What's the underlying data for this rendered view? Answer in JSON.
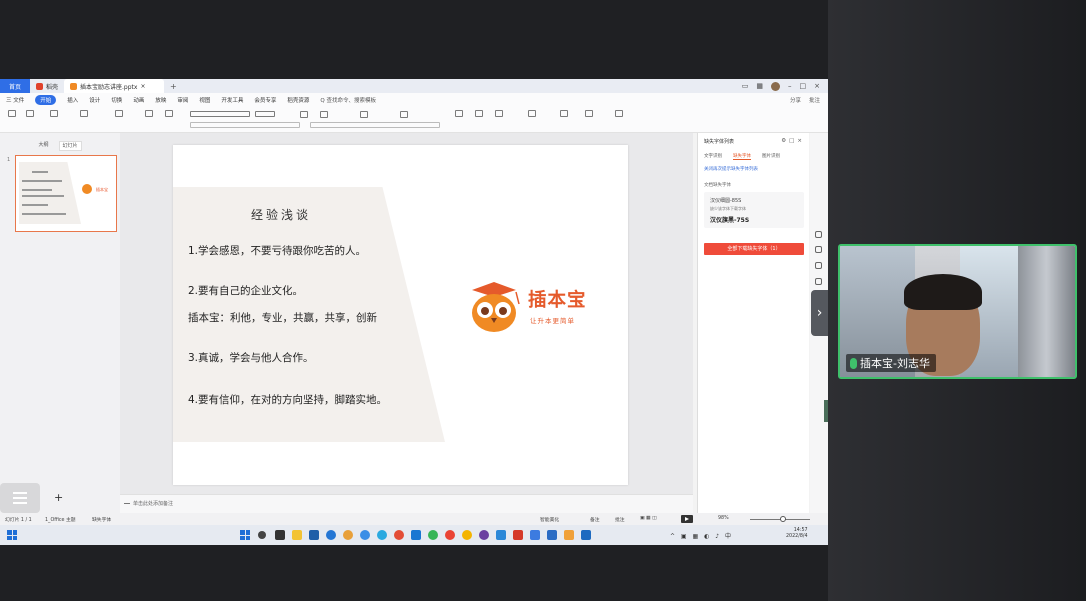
{
  "wps": {
    "tabs": [
      {
        "label": "首页"
      },
      {
        "label": "稻壳"
      },
      {
        "label": "插本宝励志讲座.pptx"
      }
    ],
    "menu": [
      "三 文件",
      "开始",
      "插入",
      "设计",
      "切换",
      "动画",
      "放映",
      "审阅",
      "视图",
      "开发工具",
      "会员专享",
      "稻壳资源"
    ],
    "menu_search": "Q 查找命令、搜索模板",
    "menu_right": [
      "分享",
      "批注"
    ],
    "thumb_tabs": [
      "大纲",
      "幻灯片"
    ],
    "thumb_number": "1",
    "slide": {
      "title": "经验浅谈",
      "points": [
        "1.学会感恩，不要亏待跟你吃苦的人。",
        "2.要有自己的企业文化。",
        "插本宝：利他，专业，共赢，共享，创新",
        "3.真诚，学会与他人合作。",
        "4.要有信仰，在对的方向坚持，脚踏实地。"
      ],
      "logo_name": "插本宝",
      "logo_slogan": "让升本更简单"
    },
    "notes_placeholder": "单击此处添加备注",
    "task_pane": {
      "title": "缺失字体列表",
      "tabs": [
        "文字识别",
        "缺失字体",
        "图片识别"
      ],
      "link": "关闭再次提示缺失字体列表",
      "section": "文档缺失字体",
      "font_box_line1": "汉仪细圆-85S",
      "font_box_line2": "缺少该字体下载字体",
      "font_box_line3": "汉仪旗黑-75S",
      "button": "全部下载缺失字体（1）"
    },
    "status": {
      "page": "幻灯片 1 / 1",
      "theme": "1_Office 主题",
      "font": "缺失字体",
      "beautify": "智能美化",
      "notes": "备注",
      "comments": "批注",
      "zoom": "98%"
    },
    "clock": {
      "time": "14:57",
      "date": "2022/8/4"
    },
    "video": {
      "name": "插本宝-刘志华"
    }
  }
}
